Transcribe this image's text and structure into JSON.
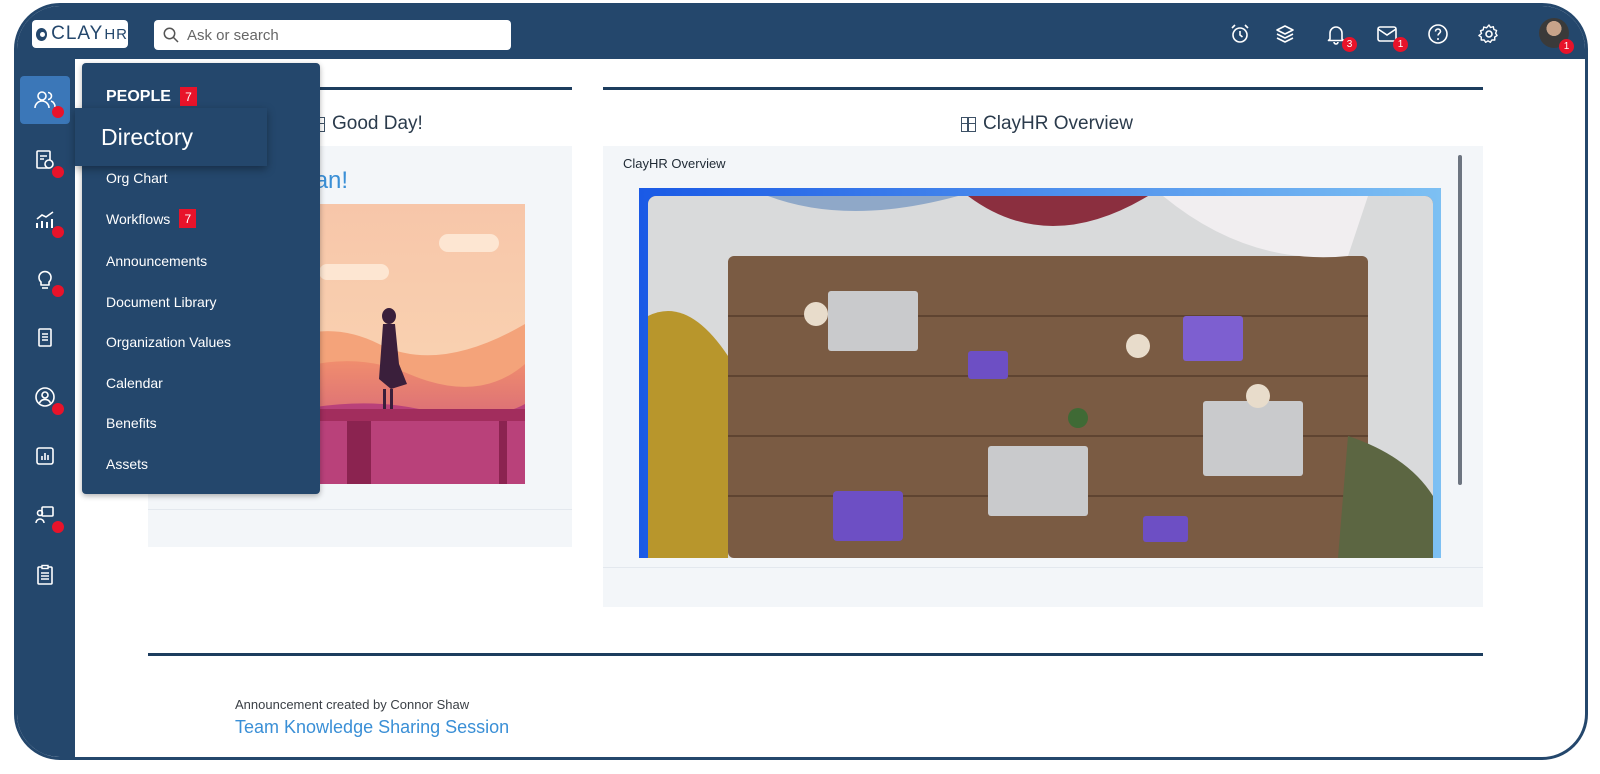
{
  "topbar": {
    "logo_text": "CLAY",
    "logo_suffix": "HR",
    "search_placeholder": "Ask or search",
    "notifications_badge": "3",
    "messages_badge": "1",
    "avatar_badge": "1"
  },
  "rail": {
    "items": [
      {
        "icon": "people-icon",
        "active": true,
        "dot": true
      },
      {
        "icon": "document-time-icon",
        "dot": true
      },
      {
        "icon": "chart-trend-icon",
        "dot": true
      },
      {
        "icon": "lightbulb-icon",
        "dot": true
      },
      {
        "icon": "notes-icon",
        "dot": false
      },
      {
        "icon": "user-circle-icon",
        "dot": true
      },
      {
        "icon": "report-icon",
        "dot": false
      },
      {
        "icon": "training-icon",
        "dot": true
      },
      {
        "icon": "clipboard-icon",
        "dot": false
      }
    ]
  },
  "menu": {
    "title": "PEOPLE",
    "title_badge": "7",
    "tooltip": "Directory",
    "items": [
      {
        "label": "Org Chart"
      },
      {
        "label": "Workflows",
        "badge": "7"
      },
      {
        "label": "Announcements"
      },
      {
        "label": "Document Library"
      },
      {
        "label": "Organization Values"
      },
      {
        "label": "Calendar"
      },
      {
        "label": "Benefits"
      },
      {
        "label": "Assets"
      }
    ]
  },
  "main": {
    "left_heading": "Good Day!",
    "greeting": "apman!",
    "right_heading": "ClayHR Overview",
    "right_label": "ClayHR Overview",
    "announcement_meta": "Announcement created by Connor Shaw",
    "announcement_title": "Team Knowledge Sharing Session"
  },
  "colors": {
    "brand_navy": "#24476c",
    "active_blue": "#3b77b8",
    "alert_red": "#e8132a",
    "link_blue": "#3a8fd6"
  }
}
